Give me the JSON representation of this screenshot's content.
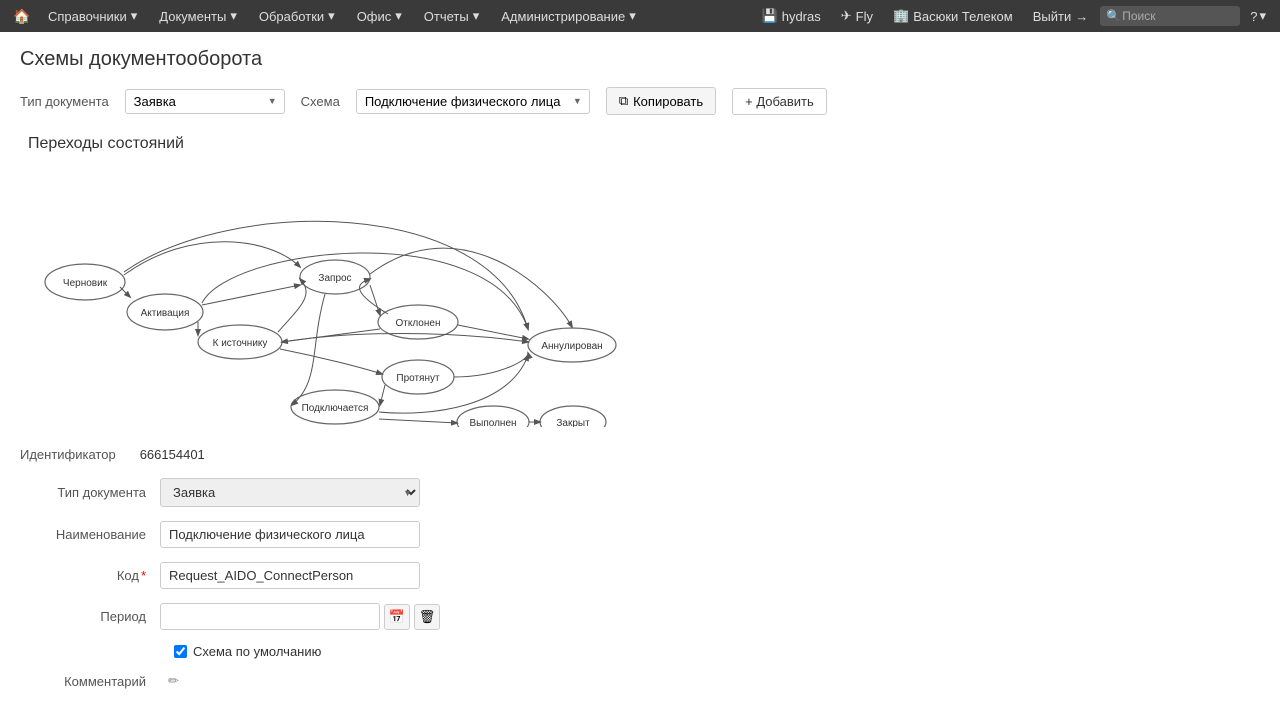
{
  "navbar": {
    "home_icon": "🏠",
    "items": [
      {
        "label": "Справочники",
        "has_arrow": true
      },
      {
        "label": "Документы",
        "has_arrow": true
      },
      {
        "label": "Обработки",
        "has_arrow": true
      },
      {
        "label": "Офис",
        "has_arrow": true
      },
      {
        "label": "Отчеты",
        "has_arrow": true
      },
      {
        "label": "Администрирование",
        "has_arrow": true
      }
    ],
    "right_items": [
      {
        "label": "hydras",
        "icon": "💾"
      },
      {
        "label": "Fly",
        "icon": "✈"
      },
      {
        "label": "Васюки Телеком",
        "icon": "🏢"
      },
      {
        "label": "Выйти",
        "icon": "→"
      }
    ],
    "search_placeholder": "Поиск",
    "help_label": "?"
  },
  "page": {
    "title": "Схемы документооборота",
    "toolbar": {
      "doc_type_label": "Тип документа",
      "doc_type_value": "Заявка",
      "schema_label": "Схема",
      "schema_value": "Подключение физического лица",
      "copy_label": "Копировать",
      "add_label": "+ Добавить"
    },
    "state_transitions": {
      "title": "Переходы состояний"
    },
    "form": {
      "id_label": "Идентификатор",
      "id_value": "666154401",
      "doc_type_label": "Тип документа",
      "doc_type_value": "Заявка",
      "name_label": "Наименование",
      "name_value": "Подключение физического лица",
      "code_label": "Код",
      "code_value": "Request_AIDO_ConnectPerson",
      "period_label": "Период",
      "period_value": "",
      "default_schema_label": "Схема по умолчанию",
      "default_schema_checked": true,
      "comment_label": "Комментарий"
    }
  }
}
